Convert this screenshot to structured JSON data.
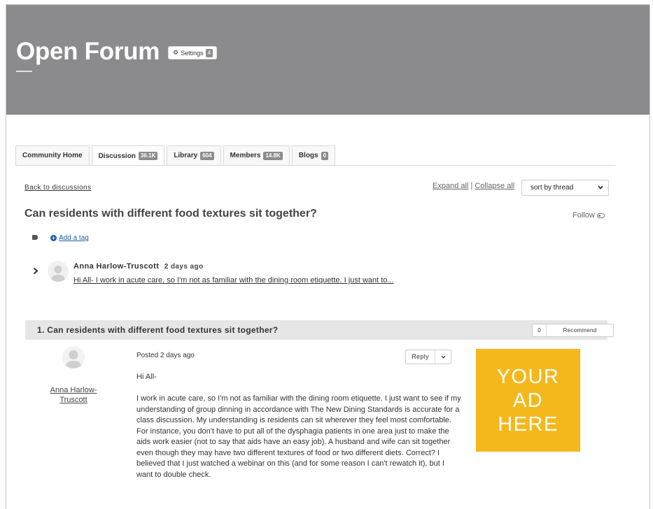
{
  "header": {
    "title": "Open Forum",
    "settings_label": "Settings",
    "settings_count": "4"
  },
  "tabs": [
    {
      "label": "Community Home",
      "count": ""
    },
    {
      "label": "Discussion",
      "count": "36.1K"
    },
    {
      "label": "Library",
      "count": "604"
    },
    {
      "label": "Members",
      "count": "14.8K"
    },
    {
      "label": "Blogs",
      "count": "0"
    }
  ],
  "toolbar": {
    "back_label": "Back to discussions",
    "expand_all": "Expand all",
    "separator": "|",
    "collapse_all": "Collapse all",
    "sort_value": "sort by thread"
  },
  "thread": {
    "title": "Can residents with different food textures sit together?",
    "follow_label": "Follow",
    "add_tag_label": "Add a tag"
  },
  "reply_summary": {
    "author": "Anna Harlow-Truscott",
    "time": "2 days ago",
    "snippet": "Hi All- I work in acute care, so I'm not as familiar with the dining room etiquette. I just want to..."
  },
  "post": {
    "number_title": "1.  Can residents with different food textures sit together?",
    "recommend_count": "0",
    "recommend_label": "Recommend",
    "author": "Anna Harlow-Truscott",
    "posted": "Posted 2 days ago",
    "reply_label": "Reply",
    "greeting": "Hi All-",
    "body": "I work in acute care, so I'm not as familiar with the dining room etiquette. I just want to see if my understanding of group dinning in accordance with The New Dining Standards is accurate for a class discussion. My understanding is residents can sit wherever they feel most comfortable. For instance, you don't have to put all of the dysphagia patients in one area just to make the aids work easier (not to say that aids have an easy job). A husband and wife can sit together even though they may have two different textures of food or two different diets. Correct? I believed that I just watched a webinar on this (and for some reason I can't rewatch it), but I want to double check."
  },
  "ad": {
    "text": "YOUR\nAD\nHERE",
    "color": "#f5b81c"
  },
  "icons": {
    "settings": "gear-icon",
    "tag": "tag-icon",
    "add_tag": "plus-circle-icon",
    "expand": "chevron-right-icon",
    "sort": "chevron-down-icon",
    "follow": "toggle-icon"
  }
}
